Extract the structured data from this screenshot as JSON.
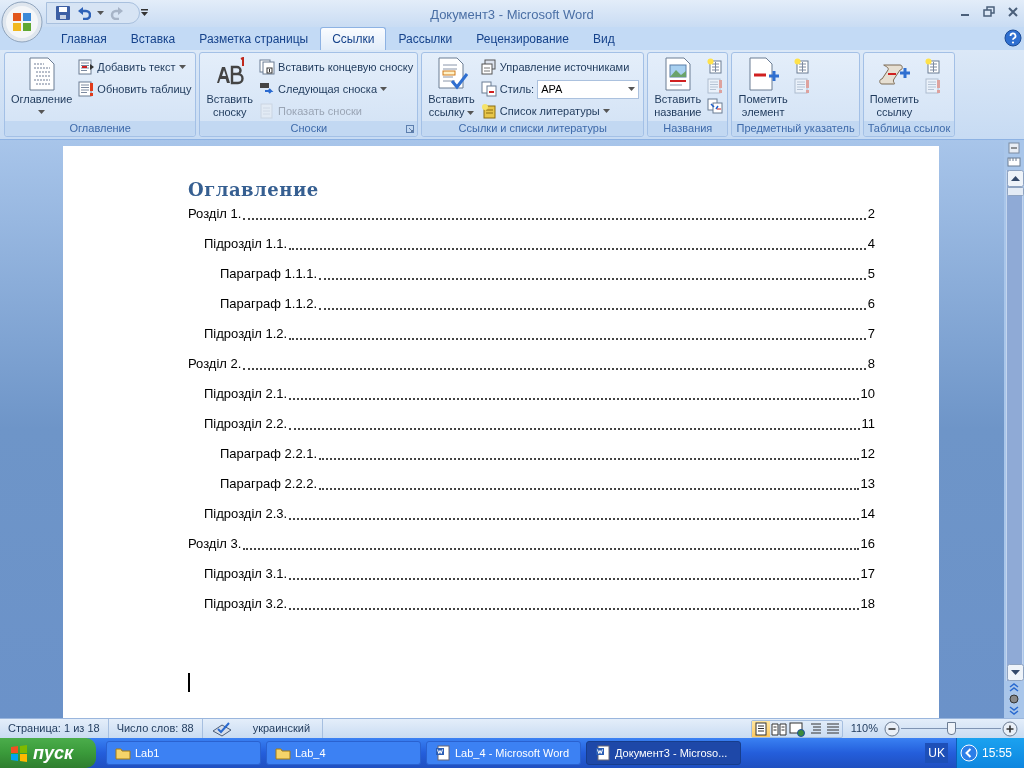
{
  "window": {
    "title": "Документ3 - Microsoft Word"
  },
  "tabs": [
    {
      "label": "Главная",
      "selected": false
    },
    {
      "label": "Вставка",
      "selected": false
    },
    {
      "label": "Разметка страницы",
      "selected": false
    },
    {
      "label": "Ссылки",
      "selected": true
    },
    {
      "label": "Рассылки",
      "selected": false
    },
    {
      "label": "Рецензирование",
      "selected": false
    },
    {
      "label": "Вид",
      "selected": false
    }
  ],
  "ribbon": {
    "groups": [
      {
        "label": "Оглавление",
        "launcher": false,
        "large": {
          "kind": "toc",
          "lines": [
            "Оглавление"
          ],
          "dropdown": true
        },
        "small": [
          {
            "kind": "button",
            "label": "Добавить текст",
            "dropdown": true,
            "disabled": false
          },
          {
            "kind": "button",
            "label": "Обновить таблицу",
            "dropdown": false,
            "disabled": false
          }
        ]
      },
      {
        "label": "Сноски",
        "launcher": true,
        "large": {
          "kind": "footnote",
          "lines": [
            "Вставить",
            "сноску"
          ],
          "dropdown": false
        },
        "small": [
          {
            "kind": "button",
            "label": "Вставить концевую сноску",
            "dropdown": false,
            "disabled": false
          },
          {
            "kind": "button",
            "label": "Следующая сноска",
            "dropdown": true,
            "disabled": false
          },
          {
            "kind": "button",
            "label": "Показать сноски",
            "dropdown": false,
            "disabled": true
          }
        ]
      },
      {
        "label": "Ссылки и списки литературы",
        "launcher": false,
        "large": {
          "kind": "citation",
          "lines": [
            "Вставить",
            "ссылку"
          ],
          "dropdown": true
        },
        "small": [
          {
            "kind": "button",
            "label": "Управление источниками",
            "dropdown": false,
            "disabled": false
          },
          {
            "kind": "field",
            "label": "Стиль:",
            "value": "APA"
          },
          {
            "kind": "button",
            "label": "Список литературы",
            "dropdown": true,
            "disabled": false
          }
        ]
      },
      {
        "label": "Названия",
        "launcher": false,
        "large": {
          "kind": "caption",
          "lines": [
            "Вставить",
            "название"
          ],
          "dropdown": false
        },
        "small": [
          {
            "kind": "icon",
            "disabled": false
          },
          {
            "kind": "icon",
            "disabled": true
          },
          {
            "kind": "icon",
            "disabled": false
          }
        ]
      },
      {
        "label": "Предметный указатель",
        "launcher": false,
        "large": {
          "kind": "mark-entry",
          "lines": [
            "Пометить",
            "элемент"
          ],
          "dropdown": false
        },
        "small": [
          {
            "kind": "icon",
            "disabled": false
          },
          {
            "kind": "icon",
            "disabled": true
          }
        ]
      },
      {
        "label": "Таблица ссылок",
        "launcher": false,
        "large": {
          "kind": "mark-citation",
          "lines": [
            "Пометить",
            "ссылку"
          ],
          "dropdown": false
        },
        "small": [
          {
            "kind": "icon",
            "disabled": false
          },
          {
            "kind": "icon",
            "disabled": true
          }
        ]
      }
    ]
  },
  "document": {
    "heading": "Оглавление",
    "toc": [
      {
        "text": "Розділ 1.",
        "page": "2",
        "children": [
          {
            "text": "Підрозділ 1.1.",
            "page": "4",
            "children": [
              {
                "text": "Параграф 1.1.1.",
                "page": "5"
              },
              {
                "text": "Параграф 1.1.2.",
                "page": "6"
              }
            ]
          },
          {
            "text": "Підрозділ 1.2.",
            "page": "7"
          }
        ]
      },
      {
        "text": "Розділ 2.",
        "page": "8",
        "children": [
          {
            "text": "Підрозділ 2.1.",
            "page": "10"
          },
          {
            "text": "Підрозділ 2.2.",
            "page": "11",
            "children": [
              {
                "text": "Параграф 2.2.1.",
                "page": "12"
              },
              {
                "text": "Параграф 2.2.2.",
                "page": "13"
              }
            ]
          },
          {
            "text": "Підрозділ 2.3.",
            "page": "14"
          }
        ]
      },
      {
        "text": "Розділ 3.",
        "page": "16",
        "children": [
          {
            "text": "Підрозділ 3.1.",
            "page": "17"
          },
          {
            "text": "Підрозділ 3.2.",
            "page": "18"
          }
        ]
      }
    ]
  },
  "status_bar": {
    "page": "Страница: 1 из 18",
    "words": "Число слов: 88",
    "language": "украинский",
    "views": [
      {
        "selected": true
      },
      {
        "selected": false
      },
      {
        "selected": false
      },
      {
        "selected": false
      },
      {
        "selected": false
      }
    ],
    "zoom": {
      "reading": "110%",
      "level": 0.5
    }
  },
  "taskbar": {
    "start": "пуск",
    "tasks": [
      {
        "kind": "folder",
        "label": "Lab1",
        "selected": false
      },
      {
        "kind": "folder",
        "label": "Lab_4",
        "selected": false
      },
      {
        "kind": "word",
        "label": "Lab_4 - Microsoft Word",
        "selected": false
      },
      {
        "kind": "word",
        "label": "Документ3 - Microso...",
        "selected": true
      }
    ],
    "language": "UK",
    "time": "15:55"
  }
}
